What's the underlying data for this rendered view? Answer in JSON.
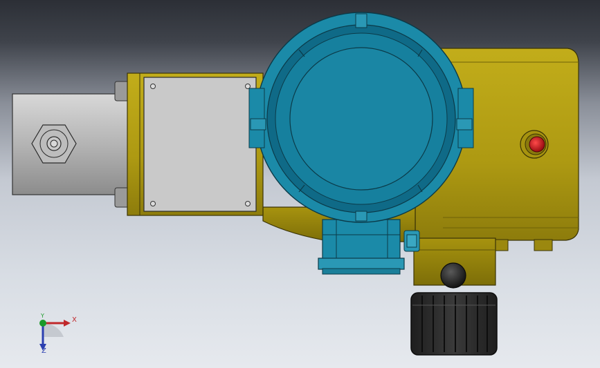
{
  "view": {
    "kind": "CAD 3D model viewport",
    "background_colors": {
      "top": "#2c2f36",
      "bottom": "#e6e9ee"
    }
  },
  "model": {
    "parts": [
      "input-shaft-housing",
      "cover-plate",
      "actuator-body",
      "round-display-housing",
      "terminal-box",
      "red-indicator-button",
      "black-knob",
      "handwheel"
    ],
    "colors": {
      "body": "#b19d14",
      "body_dark": "#8a7a0c",
      "housing_teal": "#1b8aa8",
      "housing_teal_dark": "#0f6a87",
      "cover_plate": "#c7c7c7",
      "shaft_gray": "#b8b8b8",
      "indicator_red": "#c0181e",
      "handwheel": "#2a2a2a"
    }
  },
  "triad": {
    "x_label": "X",
    "y_label": "Y",
    "z_label": "Z",
    "colors": {
      "x": "#c0282b",
      "y": "#1a9a2a",
      "z": "#2b3fb0"
    }
  }
}
